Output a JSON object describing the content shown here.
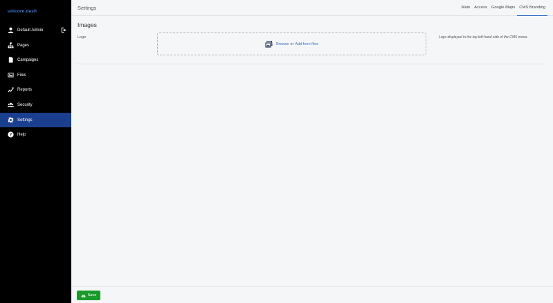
{
  "app": {
    "brand": "unicorn.dash"
  },
  "sidebar": {
    "user": {
      "label": "Default Admin",
      "icon": "user-icon"
    },
    "items": [
      {
        "label": "Pages",
        "icon": "sitemap-icon"
      },
      {
        "label": "Campaigns",
        "icon": "file-icon"
      },
      {
        "label": "Files",
        "icon": "image-icon"
      },
      {
        "label": "Reports",
        "icon": "chart-line-icon"
      },
      {
        "label": "Security",
        "icon": "users-icon"
      },
      {
        "label": "Settings",
        "icon": "gear-icon",
        "active": true
      },
      {
        "label": "Help",
        "icon": "question-icon"
      }
    ]
  },
  "header": {
    "title": "Settings",
    "tabs": [
      {
        "label": "Main"
      },
      {
        "label": "Access"
      },
      {
        "label": "Google Maps"
      },
      {
        "label": "CMS Branding",
        "active": true
      }
    ]
  },
  "main": {
    "section_title": "Images",
    "logo_field": {
      "label": "Logo",
      "browse": "Browse",
      "or": "or",
      "add_from_files": "Add from files",
      "help": "Logo displayed in the top left-hand side of the CMS menu."
    }
  },
  "footer": {
    "save_label": "Save"
  },
  "colors": {
    "sidebar_bg": "#000000",
    "active_bg": "#1a3f8f",
    "accent": "#3a6fc4",
    "save": "#1a9a2a"
  }
}
